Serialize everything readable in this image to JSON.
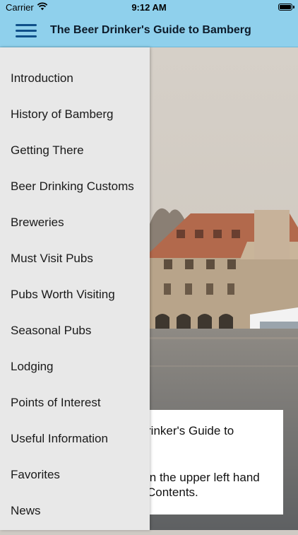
{
  "status_bar": {
    "carrier": "Carrier",
    "time": "9:12 AM",
    "icons": [
      "wifi-icon",
      "battery-icon"
    ]
  },
  "nav_bar": {
    "title": "The Beer Drinker's Guide to Bamberg",
    "menu_icon": "hamburger-menu-icon",
    "color": "#8fd0ec",
    "icon_color": "#0f4f89"
  },
  "drawer": {
    "items": [
      {
        "label": "Introduction"
      },
      {
        "label": "History of Bamberg"
      },
      {
        "label": "Getting There"
      },
      {
        "label": "Beer Drinking Customs"
      },
      {
        "label": "Breweries"
      },
      {
        "label": "Must Visit Pubs"
      },
      {
        "label": "Pubs Worth Visiting"
      },
      {
        "label": "Seasonal Pubs"
      },
      {
        "label": "Lodging"
      },
      {
        "label": "Points of Interest"
      },
      {
        "label": "Useful Information"
      },
      {
        "label": "Favorites"
      },
      {
        "label": "News"
      }
    ]
  },
  "content_card": {
    "line1": "rinker's Guide to",
    "line2": "in the upper left hand",
    "line3": "Contents."
  }
}
